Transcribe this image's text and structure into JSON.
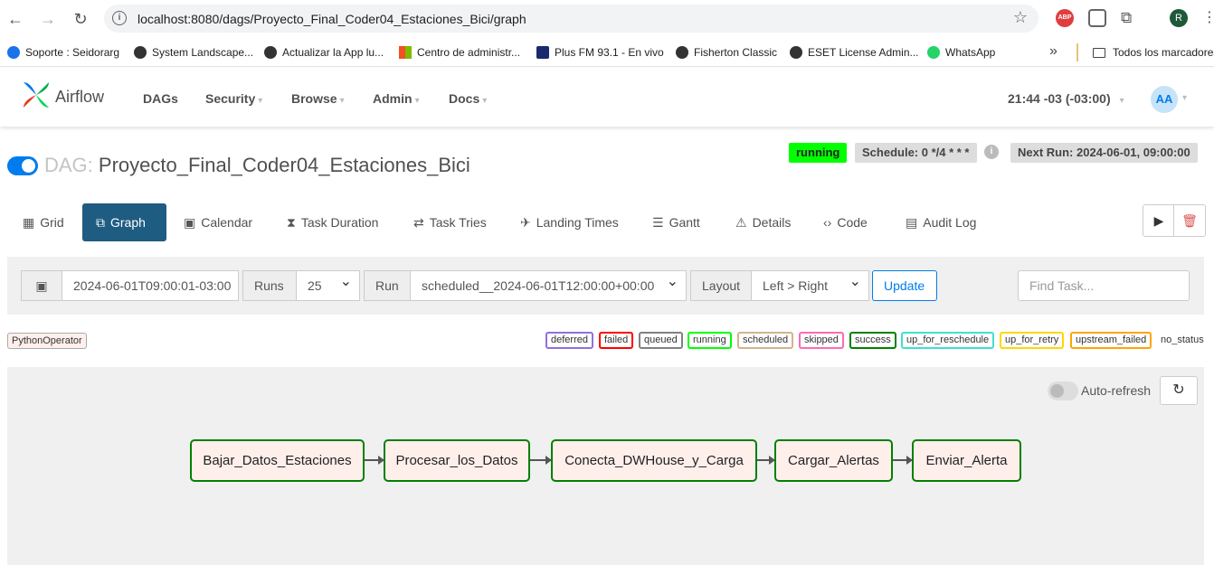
{
  "browser": {
    "url": "localhost:8080/dags/Proyecto_Final_Coder04_Estaciones_Bici/graph",
    "abp_label": "ABP",
    "profile_initial": "R",
    "bookmarks": [
      "Soporte : Seidorarg",
      "System Landscape...",
      "Actualizar la App lu...",
      "Centro de administr...",
      "Plus FM 93.1 - En vivo",
      "Fisherton Classic",
      "ESET License Admin...",
      "WhatsApp"
    ],
    "all_bookmarks": "Todos los marcadores"
  },
  "navbar": {
    "brand": "Airflow",
    "items": [
      "DAGs",
      "Security",
      "Browse",
      "Admin",
      "Docs"
    ],
    "clock": "21:44 -03 (-03:00)",
    "user_initials": "AA"
  },
  "dag": {
    "label": "DAG:",
    "id": "Proyecto_Final_Coder04_Estaciones_Bici",
    "state": "running",
    "schedule": "Schedule: 0 */4 * * *",
    "next_run": "Next Run: 2024-06-01, 09:00:00"
  },
  "tabs": [
    "Grid",
    "Graph",
    "Calendar",
    "Task Duration",
    "Task Tries",
    "Landing Times",
    "Gantt",
    "Details",
    "Code",
    "Audit Log"
  ],
  "filters": {
    "date": "2024-06-01T09:00:01-03:00",
    "runs_label": "Runs",
    "runs_value": "25",
    "run_label": "Run",
    "run_value": "scheduled__2024-06-01T12:00:00+00:00",
    "layout_label": "Layout",
    "layout_value": "Left > Right",
    "update_label": "Update",
    "find_placeholder": "Find Task..."
  },
  "legend": {
    "operator": "PythonOperator",
    "states": [
      {
        "label": "deferred",
        "color": "#9370db"
      },
      {
        "label": "failed",
        "color": "#ff0000"
      },
      {
        "label": "queued",
        "color": "#808080"
      },
      {
        "label": "running",
        "color": "#00ff00"
      },
      {
        "label": "scheduled",
        "color": "#d2b48c"
      },
      {
        "label": "skipped",
        "color": "#ff69b4"
      },
      {
        "label": "success",
        "color": "#008000"
      },
      {
        "label": "up_for_reschedule",
        "color": "#40e0d0"
      },
      {
        "label": "up_for_retry",
        "color": "#ffd700"
      },
      {
        "label": "upstream_failed",
        "color": "#ffa500"
      },
      {
        "label": "no_status",
        "color": "transparent"
      }
    ]
  },
  "graph": {
    "auto_refresh_label": "Auto-refresh",
    "tasks": [
      "Bajar_Datos_Estaciones",
      "Procesar_los_Datos",
      "Conecta_DWHouse_y_Carga",
      "Cargar_Alertas",
      "Enviar_Alerta"
    ]
  }
}
